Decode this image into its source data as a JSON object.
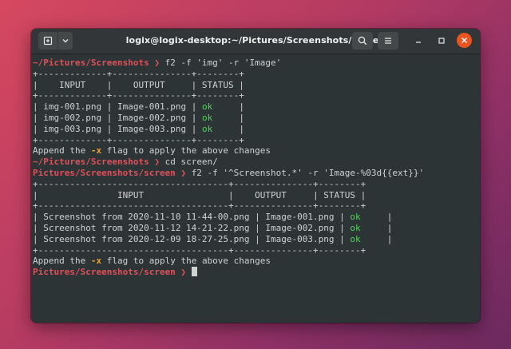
{
  "window": {
    "title": "logix@logix-desktop:~/Pictures/Screenshots/screen",
    "colors": {
      "titlebar": "#333638",
      "terminal_bg": "#2d3436",
      "close_button": "#e95420"
    }
  },
  "icons": {
    "new_tab": "new-tab-icon",
    "tab_menu": "chevron-down-icon",
    "search": "search-icon",
    "menu": "hamburger-menu-icon",
    "minimize": "minimize-icon",
    "maximize": "maximize-icon",
    "close": "close-icon"
  },
  "terminal": {
    "colors": {
      "path": "#e0505a",
      "flag": "#e8a33d",
      "ok": "#4fd25a",
      "text": "#d0d2d2"
    },
    "cmd1": {
      "path": "~/Pictures/Screenshots",
      "prompt": " ❯ ",
      "command": "f2 -f 'img' -r 'Image'"
    },
    "table1": {
      "border": "+-------------+---------------+--------+",
      "header": "|    INPUT    |    OUTPUT     | STATUS |",
      "rows": [
        {
          "input": "img-001.png",
          "output": "Image-001.png",
          "status": "ok"
        },
        {
          "input": "img-002.png",
          "output": "Image-002.png",
          "status": "ok"
        },
        {
          "input": "img-003.png",
          "output": "Image-003.png",
          "status": "ok"
        }
      ]
    },
    "append1": {
      "before": "Append the ",
      "flag": "-x",
      "after": " flag to apply the above changes"
    },
    "cmd2": {
      "path": "~/Pictures/Screenshots",
      "prompt": " ❯ ",
      "command": "cd screen/"
    },
    "cmd3": {
      "path": "Pictures/Screenshots/screen",
      "prompt": " ❯ ",
      "command": "f2 -f '^Screenshot.*' -r 'Image-%03d{{ext}}'"
    },
    "table2": {
      "border": "+------------------------------------+---------------+--------+",
      "header": "|               INPUT                |    OUTPUT     | STATUS |",
      "rows": [
        {
          "input": "Screenshot from 2020-11-10 11-44-00.png",
          "output": "Image-001.png",
          "status": "ok"
        },
        {
          "input": "Screenshot from 2020-11-12 14-21-22.png",
          "output": "Image-002.png",
          "status": "ok"
        },
        {
          "input": "Screenshot from 2020-12-09 18-27-25.png",
          "output": "Image-003.png",
          "status": "ok"
        }
      ]
    },
    "append2": {
      "before": "Append the ",
      "flag": "-x",
      "after": " flag to apply the above changes"
    },
    "cmd4": {
      "path": "Pictures/Screenshots/screen",
      "prompt": " ❯ "
    }
  }
}
